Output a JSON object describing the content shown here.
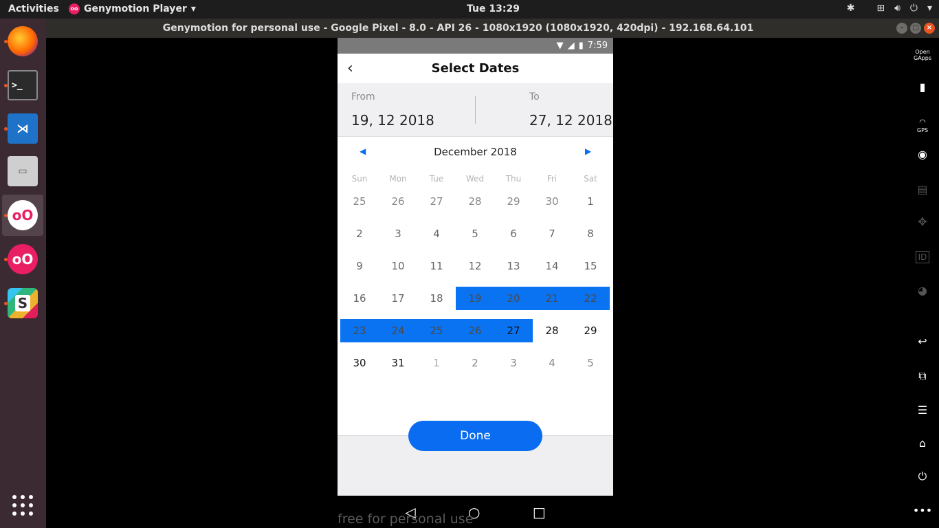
{
  "topbar": {
    "activities": "Activities",
    "app_name": "Genymotion Player",
    "clock": "Tue 13:29"
  },
  "window": {
    "title": "Genymotion for personal use - Google Pixel - 8.0 - API 26 - 1080x1920 (1080x1920, 420dpi) - 192.168.64.101"
  },
  "dock": {
    "items": [
      {
        "name": "firefox"
      },
      {
        "name": "terminal"
      },
      {
        "name": "vscode"
      },
      {
        "name": "files"
      },
      {
        "name": "genymotion"
      },
      {
        "name": "genymotion-player"
      },
      {
        "name": "slack"
      }
    ]
  },
  "phone": {
    "status_time": "7:59",
    "header_title": "Select Dates",
    "from_label": "From",
    "from_value": "19, 12 2018",
    "to_label": "To",
    "to_value": "27, 12 2018",
    "month_label": "December 2018",
    "weekdays": [
      "Sun",
      "Mon",
      "Tue",
      "Wed",
      "Thu",
      "Fri",
      "Sat"
    ],
    "weeks": [
      [
        "25",
        "26",
        "27",
        "28",
        "29",
        "30",
        "1"
      ],
      [
        "2",
        "3",
        "4",
        "5",
        "6",
        "7",
        "8"
      ],
      [
        "9",
        "10",
        "11",
        "12",
        "13",
        "14",
        "15"
      ],
      [
        "16",
        "17",
        "18",
        "19",
        "20",
        "21",
        "22"
      ],
      [
        "23",
        "24",
        "25",
        "26",
        "27",
        "28",
        "29"
      ],
      [
        "30",
        "31",
        "1",
        "2",
        "3",
        "4",
        "5"
      ]
    ],
    "done_label": "Done",
    "accent_color": "#0a6cf0"
  },
  "watermark": "free for personal use",
  "sidebar": {
    "opengapps_line1": "Open",
    "opengapps_line2": "GApps",
    "gps_label": "GPS",
    "id_label": "ID"
  }
}
